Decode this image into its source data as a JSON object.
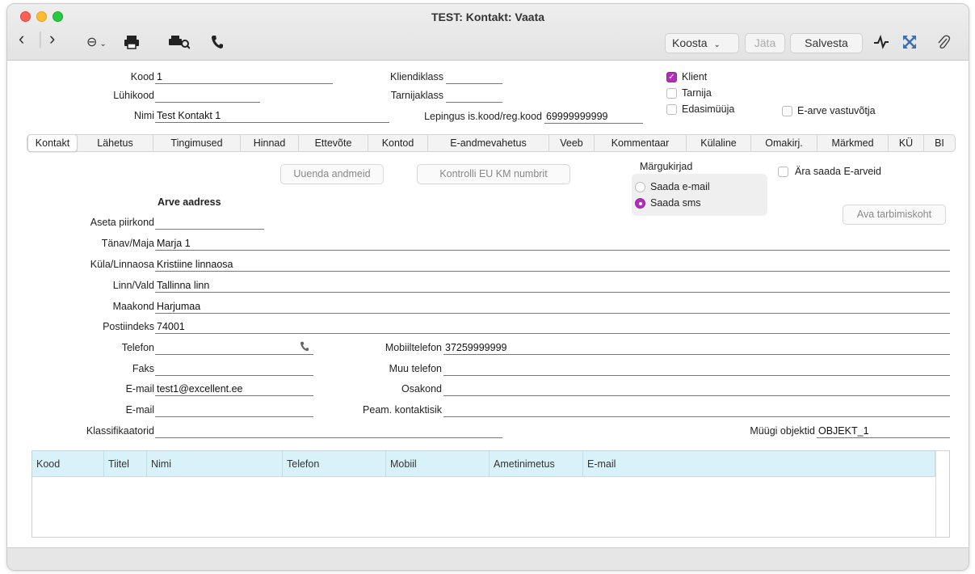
{
  "window": {
    "title": "TEST: Kontakt: Vaata"
  },
  "toolbar": {
    "back_icon": "‹",
    "forward_icon": "›",
    "more_icon": "⊖",
    "koosta": "Koosta",
    "jata": "Jäta",
    "salvesta": "Salvesta"
  },
  "header": {
    "kood_label": "Kood",
    "kood_value": "1",
    "luhikood_label": "Lühikood",
    "luhikood_value": "",
    "nimi_label": "Nimi",
    "nimi_value": "Test Kontakt 1",
    "kliendiklass_label": "Kliendiklass",
    "kliendiklass_value": "",
    "tarnijaklass_label": "Tarnijaklass",
    "tarnijaklass_value": "",
    "lepingus_label": "Lepingus is.kood/reg.kood",
    "lepingus_value": "69999999999",
    "klient_label": "Klient",
    "klient_checked": true,
    "tarnija_label": "Tarnija",
    "edasimuuja_label": "Edasimüüja",
    "earve_label": "E-arve vastuvõtja"
  },
  "tabs": [
    {
      "label": "Kontakt",
      "active": true
    },
    {
      "label": "Lähetus"
    },
    {
      "label": "Tingimused"
    },
    {
      "label": "Hinnad"
    },
    {
      "label": "Ettevõte"
    },
    {
      "label": "Kontod"
    },
    {
      "label": "E-andmevahetus"
    },
    {
      "label": "Veeb"
    },
    {
      "label": "Kommentaar"
    },
    {
      "label": "Külaline"
    },
    {
      "label": "Omakirj."
    },
    {
      "label": "Märkmed"
    },
    {
      "label": "KÜ"
    },
    {
      "label": "BI"
    }
  ],
  "actions": {
    "uuenda": "Uuenda andmeid",
    "kontrolli": "Kontrolli EU KM numbrit",
    "ava_tarbimiskoht": "Ava tarbimiskoht"
  },
  "margukirjad": {
    "title": "Märgukirjad",
    "option1": "Saada e-mail",
    "option2": "Saada sms",
    "selected": "Saada sms",
    "ara_saada_label": "Ära saada E-arveid"
  },
  "address": {
    "section_title": "Arve aadress",
    "aseta_label": "Aseta piirkond",
    "aseta_value": "",
    "tanav_label": "Tänav/Maja",
    "tanav_value": "Marja 1",
    "kula_label": "Küla/Linnaosa",
    "kula_value": "Kristiine linnaosa",
    "linn_label": "Linn/Vald",
    "linn_value": "Tallinna linn",
    "maakond_label": "Maakond",
    "maakond_value": "Harjumaa",
    "postiindeks_label": "Postiindeks",
    "postiindeks_value": "74001"
  },
  "contact": {
    "telefon_label": "Telefon",
    "telefon_value": "",
    "faks_label": "Faks",
    "faks_value": "",
    "email1_label": "E-mail",
    "email1_value": "test1@excellent.ee",
    "email2_label": "E-mail",
    "email2_value": "",
    "klass_label": "Klassifikaatorid",
    "klass_value": "",
    "mobiil_label": "Mobiiltelefon",
    "mobiil_value": "37259999999",
    "muu_label": "Muu telefon",
    "muu_value": "",
    "osakond_label": "Osakond",
    "osakond_value": "",
    "peam_label": "Peam. kontaktisik",
    "peam_value": "",
    "myygi_label": "Müügi objektid",
    "myygi_value": "OBJEKT_1"
  },
  "grid": {
    "columns": [
      "Kood",
      "Tiitel",
      "Nimi",
      "Telefon",
      "Mobiil",
      "Ametinimetus",
      "E-mail"
    ]
  },
  "colors": {
    "accent": "#b12fb7",
    "grid_header": "#d9f1f8"
  }
}
